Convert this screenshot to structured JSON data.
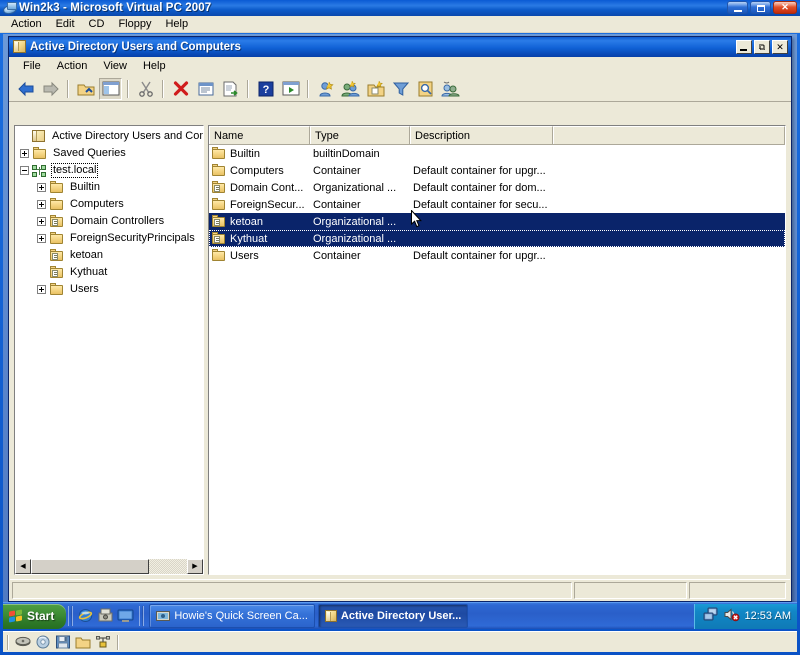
{
  "host_window": {
    "title": "Win2k3 - Microsoft Virtual PC 2007",
    "icon": "virtual-pc-icon",
    "menus": [
      "Action",
      "Edit",
      "CD",
      "Floppy",
      "Help"
    ],
    "caption_buttons": [
      "minimize",
      "maximize",
      "close"
    ],
    "status_icons": [
      "hard-disk-icon",
      "cd-drive-icon",
      "floppy-icon",
      "shared-folder-icon",
      "network-icon"
    ]
  },
  "ad_window": {
    "title": "Active Directory Users and Computers",
    "icon": "mmc-console-icon",
    "caption_buttons": [
      "minimize",
      "restore",
      "close"
    ],
    "menus": [
      "File",
      "Action",
      "View",
      "Help"
    ],
    "toolbar": [
      {
        "name": "back-button",
        "icon": "left-arrow-icon"
      },
      {
        "name": "forward-button",
        "icon": "right-arrow-icon"
      },
      {
        "name": "up-one-level-button",
        "icon": "folder-up-icon"
      },
      {
        "name": "show-hide-tree-button",
        "icon": "console-tree-icon",
        "pressed": true
      },
      {
        "name": "cut-button",
        "icon": "scissors-icon"
      },
      {
        "name": "delete-button",
        "icon": "red-x-icon"
      },
      {
        "name": "properties-button",
        "icon": "properties-icon"
      },
      {
        "name": "export-list-button",
        "icon": "export-list-icon"
      },
      {
        "name": "help-button",
        "icon": "question-mark-icon"
      },
      {
        "name": "show-console-button",
        "icon": "console-window-icon"
      },
      {
        "name": "new-user-button",
        "icon": "new-user-icon"
      },
      {
        "name": "new-group-button",
        "icon": "new-group-icon"
      },
      {
        "name": "new-ou-button",
        "icon": "new-ou-icon"
      },
      {
        "name": "filter-button",
        "icon": "funnel-icon"
      },
      {
        "name": "find-button",
        "icon": "find-icon"
      },
      {
        "name": "delegate-control-button",
        "icon": "delegate-control-icon"
      }
    ],
    "tree": [
      {
        "label": "Active Directory Users and Comput",
        "indent": 0,
        "expander": "none",
        "icon": "mmc-console-icon",
        "selected": false
      },
      {
        "label": "Saved Queries",
        "indent": 1,
        "expander": "plus",
        "icon": "folder-icon",
        "selected": false
      },
      {
        "label": "test.local",
        "indent": 1,
        "expander": "minus",
        "icon": "domain-icon",
        "selected": true
      },
      {
        "label": "Builtin",
        "indent": 2,
        "expander": "plus",
        "icon": "folder-icon",
        "selected": false
      },
      {
        "label": "Computers",
        "indent": 2,
        "expander": "plus",
        "icon": "folder-icon",
        "selected": false
      },
      {
        "label": "Domain Controllers",
        "indent": 2,
        "expander": "plus",
        "icon": "ou-folder-icon",
        "selected": false
      },
      {
        "label": "ForeignSecurityPrincipals",
        "indent": 2,
        "expander": "plus",
        "icon": "folder-icon",
        "selected": false
      },
      {
        "label": "ketoan",
        "indent": 2,
        "expander": "none",
        "icon": "ou-folder-icon",
        "selected": false
      },
      {
        "label": "Kythuat",
        "indent": 2,
        "expander": "none",
        "icon": "ou-folder-icon",
        "selected": false
      },
      {
        "label": "Users",
        "indent": 2,
        "expander": "plus",
        "icon": "folder-icon",
        "selected": false
      }
    ],
    "list_columns": [
      "Name",
      "Type",
      "Description"
    ],
    "list_rows": [
      {
        "name": "Builtin",
        "type": "builtinDomain",
        "description": "",
        "icon": "folder-icon",
        "selected": false,
        "focused": false
      },
      {
        "name": "Computers",
        "type": "Container",
        "description": "Default container for upgr...",
        "icon": "folder-icon",
        "selected": false,
        "focused": false
      },
      {
        "name": "Domain Cont...",
        "type": "Organizational ...",
        "description": "Default container for dom...",
        "icon": "ou-folder-icon",
        "selected": false,
        "focused": false
      },
      {
        "name": "ForeignSecur...",
        "type": "Container",
        "description": "Default container for secu...",
        "icon": "folder-icon",
        "selected": false,
        "focused": false
      },
      {
        "name": "ketoan",
        "type": "Organizational ...",
        "description": "",
        "icon": "ou-folder-icon",
        "selected": true,
        "focused": false
      },
      {
        "name": "Kythuat",
        "type": "Organizational ...",
        "description": "",
        "icon": "ou-folder-icon",
        "selected": true,
        "focused": true
      },
      {
        "name": "Users",
        "type": "Container",
        "description": "Default container for upgr...",
        "icon": "folder-icon",
        "selected": false,
        "focused": false
      }
    ],
    "status_panes": [
      "",
      "",
      ""
    ]
  },
  "taskbar": {
    "start_label": "Start",
    "quick_launch": [
      "internet-explorer-icon",
      "media-player-icon",
      "show-desktop-icon"
    ],
    "tasks": [
      {
        "label": "Howie's Quick Screen Ca...",
        "icon": "screen-capture-icon",
        "active": false
      },
      {
        "label": "Active Directory User...",
        "icon": "mmc-console-icon",
        "active": true
      }
    ],
    "tray_icons": [
      "network-connection-icon",
      "volume-muted-icon"
    ],
    "clock": "12:53 AM"
  },
  "colors": {
    "selection": "#0a246a",
    "title_blue": "#0a58cf",
    "chrome": "#ece9d8",
    "desktop": "#5f8dd3"
  }
}
